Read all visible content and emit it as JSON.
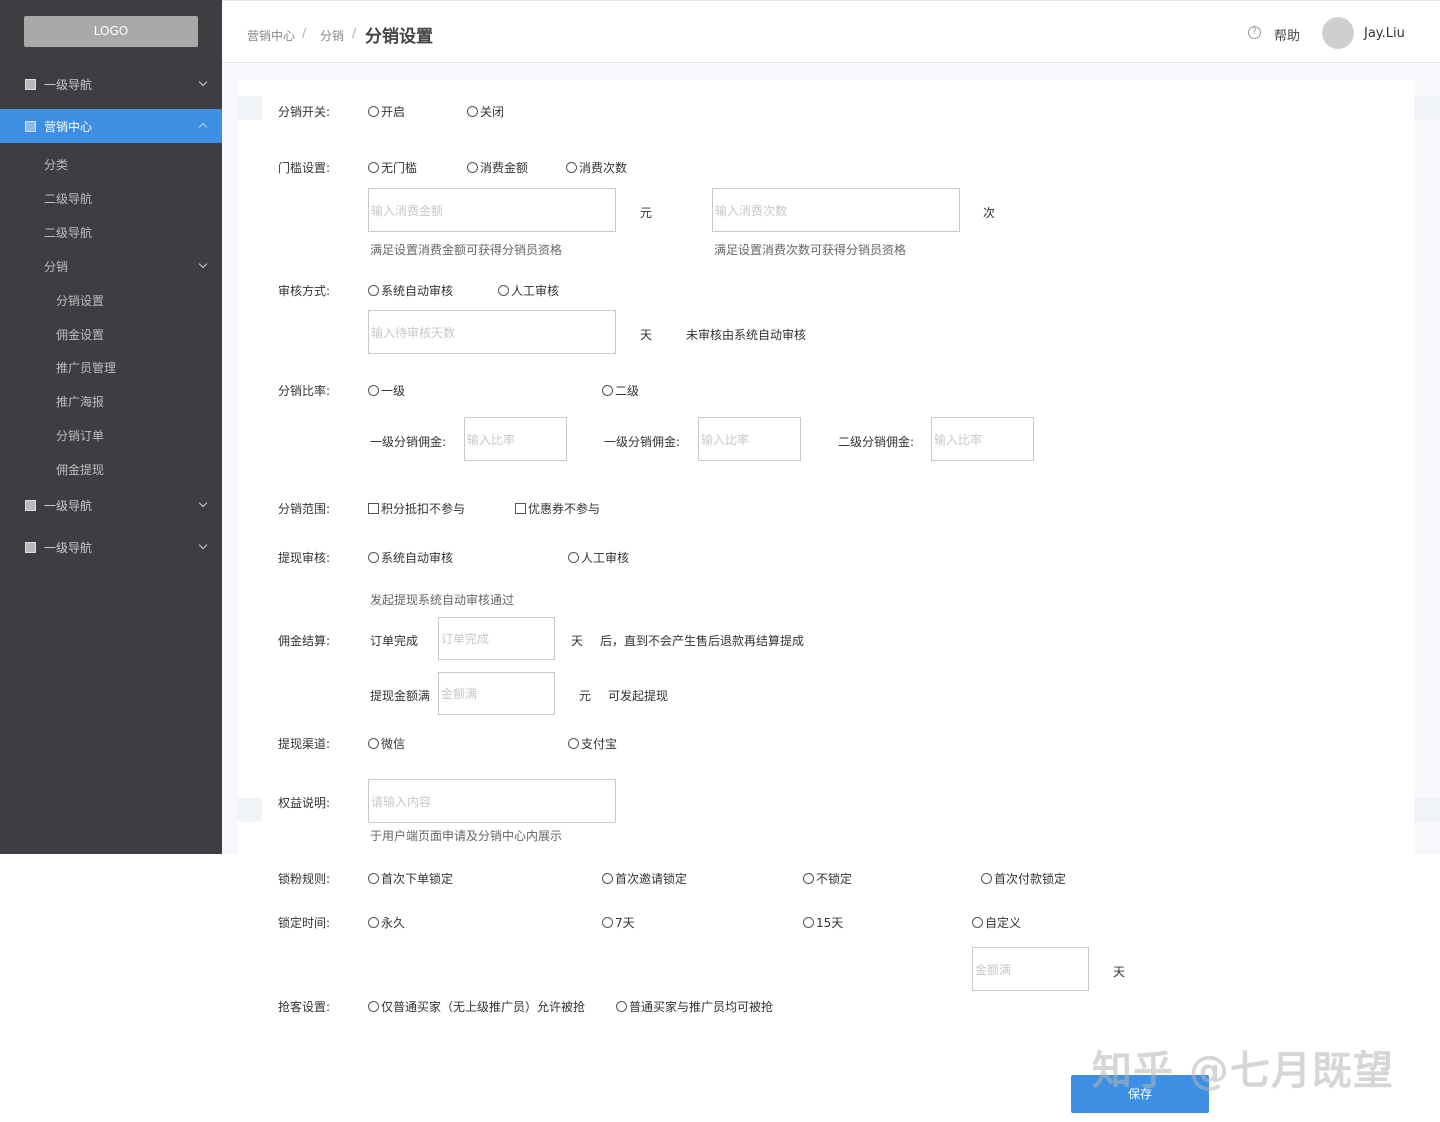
{
  "sidebar": {
    "logo": "LOGO",
    "nav1": "一级导航",
    "marketing": "营销中心",
    "sub_category": "分类",
    "sub_nav2a": "二级导航",
    "sub_nav2b": "二级导航",
    "sub_distribution": "分销",
    "items": [
      "分销设置",
      "佣金设置",
      "推广员管理",
      "推广海报",
      "分销订单",
      "佣金提现"
    ],
    "nav_bottom1": "一级导航",
    "nav_bottom2": "一级导航"
  },
  "header": {
    "breadcrumb1": "营销中心",
    "breadcrumb2": "分销",
    "sep": "/",
    "current": "分销设置",
    "help_icon": "?",
    "help": "帮助",
    "user": "Jay.Liu"
  },
  "form": {
    "switch_label": "分销开关:",
    "switch_on": "开启",
    "switch_off": "关闭",
    "threshold_label": "门槛设置:",
    "threshold_none": "无门槛",
    "threshold_amount": "消费金额",
    "threshold_count": "消费次数",
    "amount_placeholder": "输入消费金额",
    "amount_unit": "元",
    "count_placeholder": "输入消费次数",
    "count_unit": "次",
    "amount_hint": "满足设置消费金额可获得分销员资格",
    "count_hint": "满足设置消费次数可获得分销员资格",
    "review_label": "审核方式:",
    "review_auto": "系统自动审核",
    "review_manual": "人工审核",
    "review_days_placeholder": "输入待审核天数",
    "review_days_unit": "天",
    "review_days_hint": "未审核由系统自动审核",
    "ratio_label": "分销比率:",
    "ratio_level1": "一级",
    "ratio_level2": "二级",
    "commission1_label": "一级分销佣金:",
    "commission1b_label": "一级分销佣金:",
    "commission2_label": "二级分销佣金:",
    "ratio_placeholder": "输入比率",
    "scope_label": "分销范围:",
    "scope_points": "积分抵扣不参与",
    "scope_coupon": "优惠券不参与",
    "withdraw_review_label": "提现审核:",
    "withdraw_auto": "系统自动审核",
    "withdraw_manual": "人工审核",
    "withdraw_hint": "发起提现系统自动审核通过",
    "settle_label": "佣金结算:",
    "settle_order_done": "订单完成",
    "settle_order_placeholder": "订单完成",
    "settle_day_unit": "天",
    "settle_after_hint": "后，直到不会产生售后退款再结算提成",
    "withdraw_amount_label": "提现金额满",
    "withdraw_amount_placeholder": "金额满",
    "withdraw_amount_unit": "元",
    "withdraw_amount_hint": "可发起提现",
    "channel_label": "提现渠道:",
    "channel_wechat": "微信",
    "channel_alipay": "支付宝",
    "rights_label": "权益说明:",
    "rights_placeholder": "请输入内容",
    "rights_hint": "于用户端页面申请及分销中心内展示",
    "lock_rule_label": "锁粉规则:",
    "lock_first_order": "首次下单锁定",
    "lock_first_invite": "首次邀请锁定",
    "lock_none": "不锁定",
    "lock_first_pay": "首次付款锁定",
    "lock_time_label": "锁定时间:",
    "lock_forever": "永久",
    "lock_7": "7天",
    "lock_15": "15天",
    "lock_custom": "自定义",
    "lock_custom_placeholder": "金额满",
    "lock_custom_unit": "天",
    "grab_label": "抢客设置:",
    "grab_only_normal": "仅普通买家（无上级推广员）允许被抢",
    "grab_all": "普通买家与推广员均可被抢",
    "save": "保存"
  },
  "watermark": "知乎 @七月既望",
  "colors": {
    "accent": "#3d8fe3",
    "sidebar_bg": "#3c3e42"
  }
}
